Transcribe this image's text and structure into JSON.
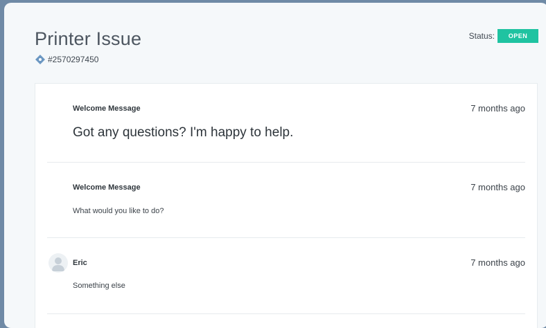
{
  "ticket": {
    "title": "Printer Issue",
    "id": "#2570297450",
    "icon": "tag-icon"
  },
  "status": {
    "label": "Status:",
    "value": "OPEN",
    "color": "#1fc3a1"
  },
  "messages": [
    {
      "sender": "Welcome Message",
      "time": "7 months ago",
      "body": "Got any questions? I'm happy to help."
    },
    {
      "sender": "Welcome Message",
      "time": "7 months ago",
      "body": "What would you like to do?"
    },
    {
      "sender": "Eric",
      "time": "7 months ago",
      "body": "Something else",
      "avatar": "user-avatar-icon"
    }
  ]
}
